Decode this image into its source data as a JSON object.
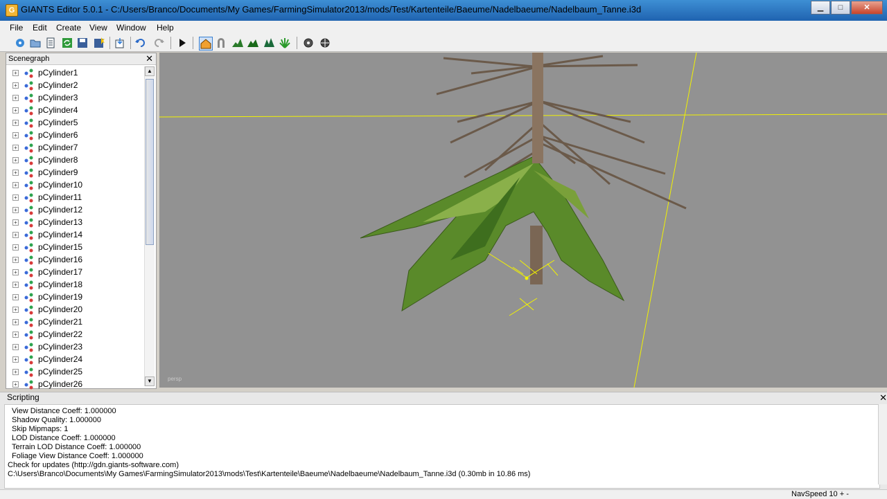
{
  "window": {
    "title": "GIANTS Editor 5.0.1 - C:/Users/Branco/Documents/My Games/FarmingSimulator2013/mods/Test/Kartenteile/Baeume/Nadelbaeume/Nadelbaum_Tanne.i3d",
    "icon_letter": "G"
  },
  "menu": [
    "File",
    "Edit",
    "Create",
    "View",
    "Window",
    "Help"
  ],
  "scenegraph": {
    "title": "Scenegraph",
    "items": [
      "pCylinder1",
      "pCylinder2",
      "pCylinder3",
      "pCylinder4",
      "pCylinder5",
      "pCylinder6",
      "pCylinder7",
      "pCylinder8",
      "pCylinder9",
      "pCylinder10",
      "pCylinder11",
      "pCylinder12",
      "pCylinder13",
      "pCylinder14",
      "pCylinder15",
      "pCylinder16",
      "pCylinder17",
      "pCylinder18",
      "pCylinder19",
      "pCylinder20",
      "pCylinder21",
      "pCylinder22",
      "pCylinder23",
      "pCylinder24",
      "pCylinder25",
      "pCylinder26"
    ]
  },
  "viewport": {
    "camera_label": "persp"
  },
  "scripting": {
    "title": "Scripting",
    "lines": [
      "View Distance Coeff: 1.000000",
      "Shadow Quality: 1.000000",
      "Skip Mipmaps: 1",
      "LOD Distance Coeff: 1.000000",
      "Terrain LOD Distance Coeff: 1.000000",
      "Foliage View Distance Coeff: 1.000000",
      "Check for updates (http://gdn.giants-software.com)",
      "C:\\Users\\Branco\\Documents\\My Games\\FarmingSimulator2013\\mods\\Test\\Kartenteile\\Baeume\\Nadelbaeume\\Nadelbaum_Tanne.i3d (0.30mb in 10.86 ms)"
    ]
  },
  "status": {
    "nav_speed": "NavSpeed 10 + -"
  }
}
